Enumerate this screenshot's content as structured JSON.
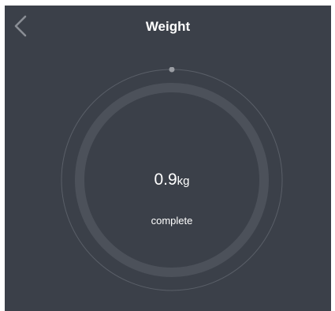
{
  "header": {
    "title": "Weight",
    "back_icon": "chevron-left-icon"
  },
  "measurement": {
    "value": "0.9",
    "unit": "kg",
    "status": "complete"
  },
  "colors": {
    "background": "#3b4049",
    "ring": "#4c515a",
    "outer_ring": "#5a5f68",
    "indicator": "#9a9da3",
    "text": "#ffffff",
    "back_icon": "#8a8e95"
  }
}
